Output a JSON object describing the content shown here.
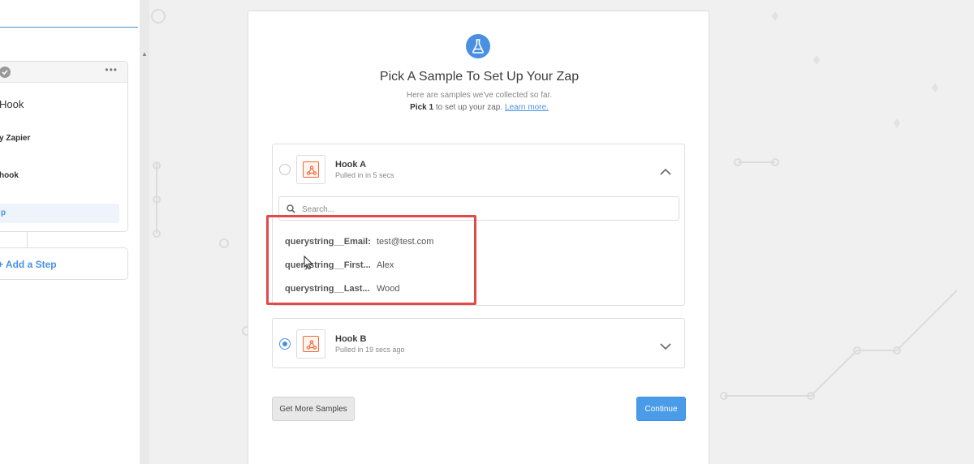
{
  "sidebar": {
    "trigger_title": "Hook",
    "app_line": "y Zapier",
    "event_line": "hook",
    "selected_item": "p",
    "menu_dots": "•••",
    "add_step_label": "Add a Step"
  },
  "main": {
    "title": "Pick A Sample To Set Up Your Zap",
    "subtitle": "Here are samples we've collected so far.",
    "pick_bold": "Pick 1",
    "pick_rest": " to set up your zap. ",
    "learn_more": "Learn more."
  },
  "samples": [
    {
      "name": "Hook A",
      "time": "Pulled in in 5 secs",
      "selected": false,
      "expanded": true,
      "search_placeholder": "Search...",
      "fields": [
        {
          "key": "querystring__Email:",
          "value": "test@test.com"
        },
        {
          "key": "querystring__First...",
          "value": "Alex"
        },
        {
          "key": "querystring__Last...",
          "value": "Wood"
        }
      ]
    },
    {
      "name": "Hook B",
      "time": "Pulled in 19 secs ago",
      "selected": true,
      "expanded": false
    }
  ],
  "buttons": {
    "get_more": "Get More Samples",
    "continue": "Continue"
  },
  "colors": {
    "accent": "#4a90e2",
    "highlight": "#e24a4a",
    "app_icon": "#f26b3a"
  },
  "icons": {
    "header": "flask-icon",
    "app": "webhook-icon",
    "search": "search-icon",
    "collapse": "chevron-up-icon",
    "expand": "chevron-down-icon"
  }
}
